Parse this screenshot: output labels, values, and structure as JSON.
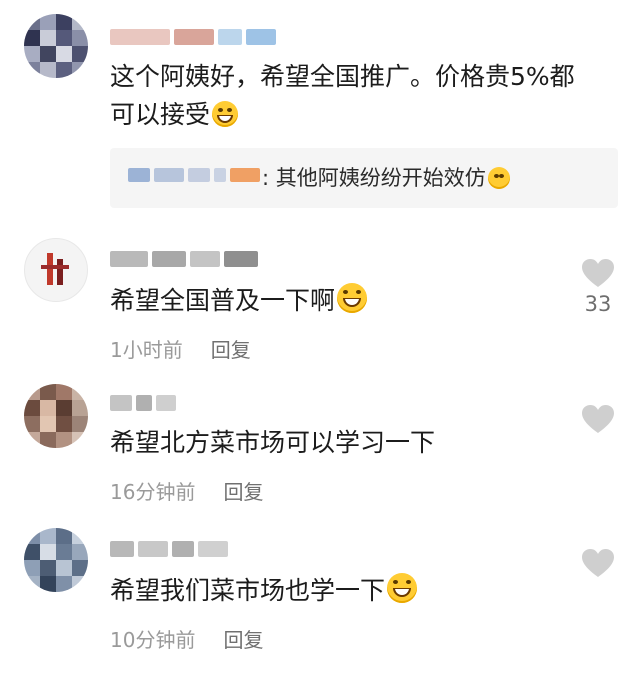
{
  "comments": [
    {
      "text_line1": "这个阿姨好，希望全国推广。价格贵5%都",
      "text_line2": "可以接受",
      "emoji": "grinning-sweat-emoji",
      "reply": {
        "text": ": 其他阿姨纷纷开始效仿"
      }
    },
    {
      "text": "希望全国普及一下啊",
      "emoji": "grinning-emoji",
      "time": "1小时前",
      "reply_label": "回复",
      "like_count": "33"
    },
    {
      "text": "希望北方菜市场可以学习一下",
      "time": "16分钟前",
      "reply_label": "回复"
    },
    {
      "text": "希望我们菜市场也学一下",
      "emoji": "laughing-tears-emoji",
      "time": "10分钟前",
      "reply_label": "回复"
    }
  ],
  "colors": {
    "like_icon": "#cfcfcf",
    "meta_text": "#9a9a9a",
    "reply_bg": "#f5f5f5"
  }
}
